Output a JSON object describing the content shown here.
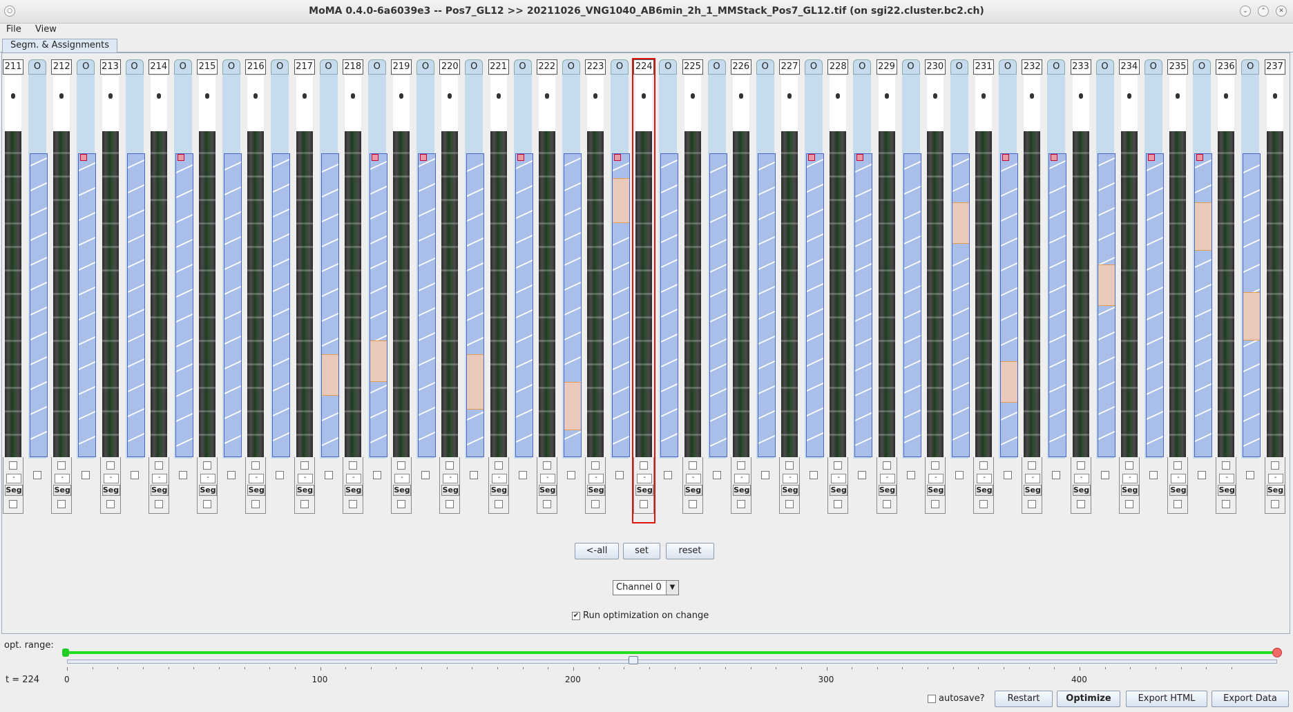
{
  "window": {
    "title": "MoMA 0.4.0-6a6039e3 -- Pos7_GL12 >> 20211026_VNG1040_AB6min_2h_1_MMStack_Pos7_GL12.tif (on sgi22.cluster.bc2.ch)"
  },
  "menu": {
    "file": "File",
    "view": "View"
  },
  "tabs": {
    "segm": "Segm. & Assignments"
  },
  "strips": [
    "211",
    "212",
    "213",
    "214",
    "215",
    "216",
    "217",
    "218",
    "219",
    "220",
    "221",
    "222",
    "223",
    "224",
    "225",
    "226",
    "227",
    "228",
    "229",
    "230",
    "231",
    "232",
    "233",
    "234",
    "235",
    "236",
    "237"
  ],
  "selected_strip": "224",
  "gap_label": "O",
  "strip_controls": {
    "minus": "-",
    "seg": "Seg"
  },
  "buttons": {
    "all": "<-all",
    "set": "set",
    "reset": "reset"
  },
  "channel": {
    "selected": "Channel 0"
  },
  "run_opt": {
    "label": "Run optimization on change",
    "checked": true
  },
  "bottom": {
    "opt_range_label": "opt. range:",
    "t_label": "t = ",
    "t_value": "224",
    "ticks": [
      "0",
      "100",
      "200",
      "300",
      "400"
    ],
    "autosave_label": "autosave?",
    "restart": "Restart",
    "optimize": "Optimize",
    "export_html": "Export HTML",
    "export_data": "Export Data"
  },
  "colors": {
    "accent": "#e01010",
    "cell_fill": "#a9bee9",
    "cell_border": "#4a66c6",
    "highlight": "#e59a4e",
    "range": "#22dd22"
  }
}
